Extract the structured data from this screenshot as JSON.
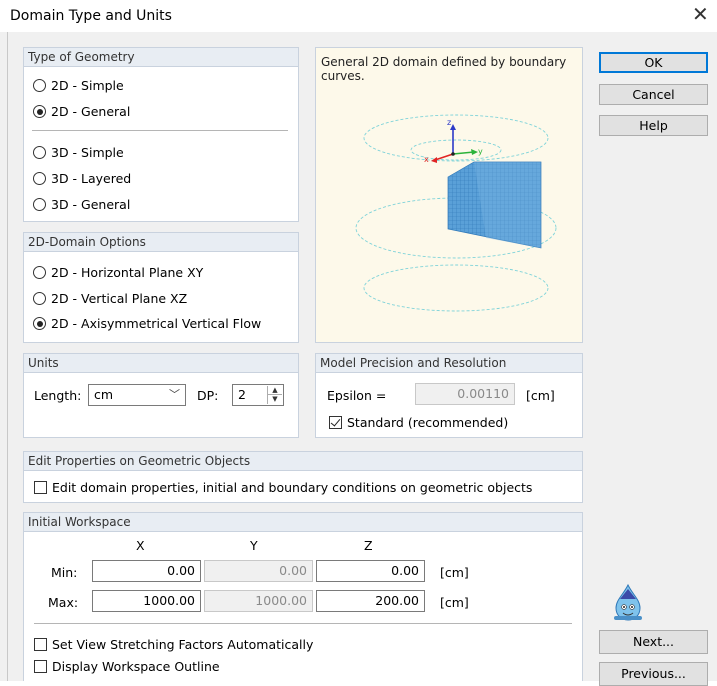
{
  "window": {
    "title": "Domain Type and Units"
  },
  "buttons": {
    "ok": "OK",
    "cancel": "Cancel",
    "help": "Help",
    "next": "Next...",
    "previous": "Previous..."
  },
  "geometry": {
    "header": "Type of Geometry",
    "options": [
      {
        "label": "2D - Simple",
        "selected": false
      },
      {
        "label": "2D - General",
        "selected": true
      },
      {
        "label": "3D - Simple",
        "selected": false
      },
      {
        "label": "3D - Layered",
        "selected": false
      },
      {
        "label": "3D - General",
        "selected": false
      }
    ]
  },
  "domain_options": {
    "header": "2D-Domain Options",
    "options": [
      {
        "label": "2D - Horizontal Plane XY",
        "selected": false
      },
      {
        "label": "2D - Vertical Plane XZ",
        "selected": false
      },
      {
        "label": "2D - Axisymmetrical Vertical Flow",
        "selected": true
      }
    ]
  },
  "preview": {
    "description": "General 2D domain defined by boundary curves.",
    "axis_labels": {
      "z": "z",
      "x": "x",
      "y": "y"
    },
    "colors": {
      "mesh": "#5aa0d8",
      "mesh_line": "#2f78b8",
      "ellipse": "#7fd3d9"
    }
  },
  "units": {
    "header": "Units",
    "length_label": "Length:",
    "length_value": "cm",
    "dp_label": "DP:",
    "dp_value": "2"
  },
  "precision": {
    "header": "Model Precision and Resolution",
    "epsilon_label": "Epsilon =",
    "epsilon_value": "0.00110",
    "epsilon_unit": "[cm]",
    "standard_label": "Standard (recommended)",
    "standard_checked": true
  },
  "edit_props": {
    "header": "Edit Properties on Geometric Objects",
    "checkbox_label": "Edit domain properties, initial and boundary conditions on geometric objects",
    "checked": false
  },
  "workspace": {
    "header": "Initial Workspace",
    "col_x": "X",
    "col_y": "Y",
    "col_z": "Z",
    "min_label": "Min:",
    "max_label": "Max:",
    "min": {
      "x": "0.00",
      "y": "0.00",
      "z": "0.00"
    },
    "max": {
      "x": "1000.00",
      "y": "1000.00",
      "z": "200.00"
    },
    "unit": "[cm]",
    "stretch_label": "Set View Stretching Factors Automatically",
    "outline_label": "Display Workspace Outline"
  },
  "icons": {
    "close": "close-icon",
    "mascot": "water-drop-mascot-icon"
  }
}
